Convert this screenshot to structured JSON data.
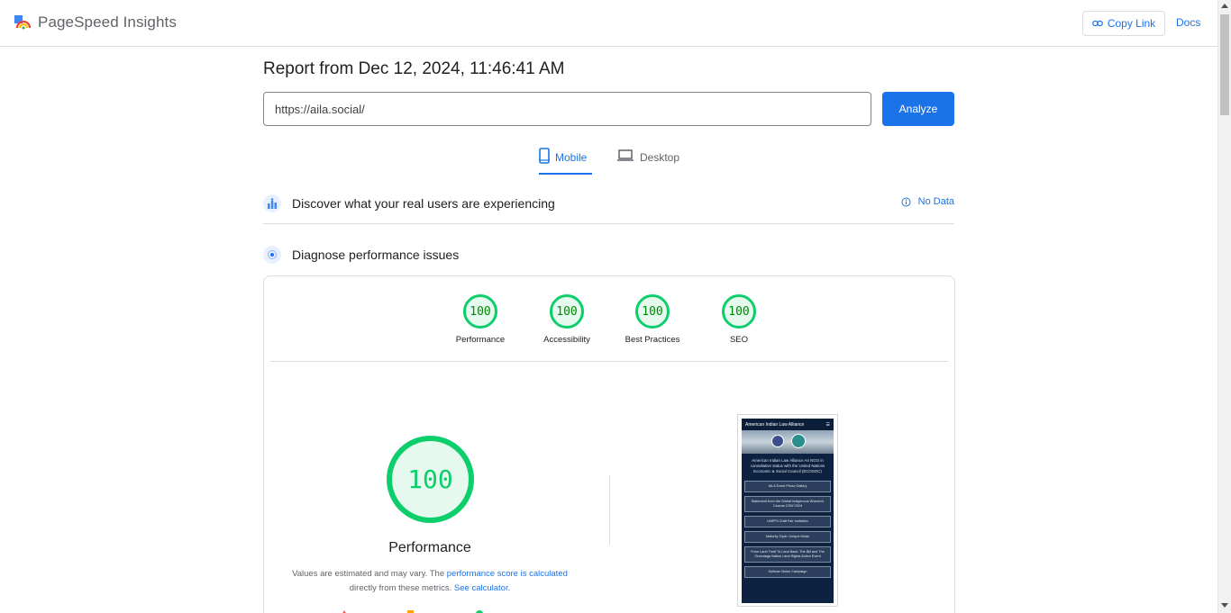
{
  "header": {
    "app_name": "PageSpeed Insights",
    "copy_link_label": "Copy Link",
    "docs_label": "Docs"
  },
  "report": {
    "title": "Report from Dec 12, 2024, 11:46:41 AM"
  },
  "search": {
    "url_value": "https://aila.social/",
    "analyze_label": "Analyze"
  },
  "tabs": [
    {
      "label": "Mobile",
      "selected": true,
      "icon": "phone-icon"
    },
    {
      "label": "Desktop",
      "selected": false,
      "icon": "laptop-icon"
    }
  ],
  "sections": {
    "discover": {
      "title": "Discover what your real users are experiencing",
      "status": "No Data"
    },
    "diagnose": {
      "title": "Diagnose performance issues"
    }
  },
  "scores": [
    {
      "label": "Performance",
      "value": "100"
    },
    {
      "label": "Accessibility",
      "value": "100"
    },
    {
      "label": "Best Practices",
      "value": "100"
    },
    {
      "label": "SEO",
      "value": "100"
    }
  ],
  "performance": {
    "score": "100",
    "label": "Performance",
    "note_prefix": "Values are estimated and may vary. The ",
    "note_link": "performance score is calculated",
    "note_mid": " directly from these metrics. ",
    "note_calc_link": "See calculator."
  },
  "thumbnail": {
    "site_title": "American Indian Law Alliance",
    "intro": "American Indian Law Alliance An NGO in consultative status with the United Nations Economic & Social Council (ECOSOC)",
    "buttons": [
      "AILA Event Photo Gallery",
      "Statement from the Global Indigenous Women's Caucus CSW 2024",
      "UNPFII Craft Fair Invitation",
      "Maturity Topic: Unique Kinds",
      "From Land Theft To Land Back: The Bill and The Onondaga Nation Land Rights Action Event",
      "Sullivan Vision Campaign"
    ]
  },
  "colors": {
    "accent": "#1a73e8",
    "pass": "#0cce6b",
    "average": "#ffa400",
    "fail": "#ff4e42"
  }
}
